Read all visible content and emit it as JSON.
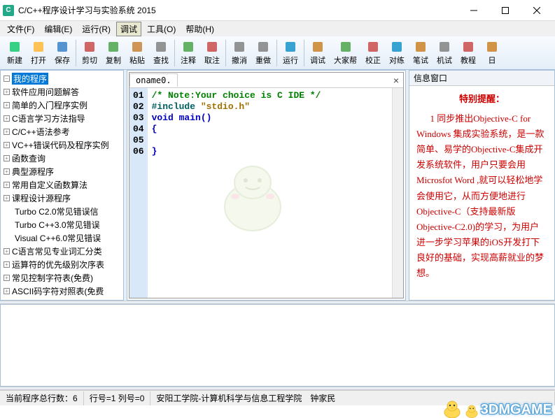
{
  "window": {
    "title": "C/C++程序设计学习与实验系统 2015"
  },
  "menu": {
    "file": "文件(F)",
    "edit": "编辑(E)",
    "run": "运行(R)",
    "debug": "调试",
    "tools": "工具(O)",
    "help": "帮助(H)"
  },
  "toolbar": [
    {
      "id": "new",
      "label": "新建",
      "color": "#2c7"
    },
    {
      "id": "open",
      "label": "打开",
      "color": "#fb4"
    },
    {
      "id": "save",
      "label": "保存",
      "color": "#48c"
    },
    {
      "sep": true
    },
    {
      "id": "cut",
      "label": "剪切",
      "color": "#c55"
    },
    {
      "id": "copy",
      "label": "复制",
      "color": "#5a5"
    },
    {
      "id": "paste",
      "label": "粘贴",
      "color": "#c84"
    },
    {
      "id": "find",
      "label": "查找",
      "color": "#888"
    },
    {
      "sep": true
    },
    {
      "id": "comment",
      "label": "注释",
      "color": "#5a5"
    },
    {
      "id": "undo",
      "label": "取注",
      "color": "#c55"
    },
    {
      "sep": true
    },
    {
      "id": "back",
      "label": "撤消",
      "color": "#888"
    },
    {
      "id": "fwd",
      "label": "重做",
      "color": "#888"
    },
    {
      "sep": true
    },
    {
      "id": "run",
      "label": "运行",
      "color": "#29c"
    },
    {
      "sep": true
    },
    {
      "id": "debug",
      "label": "调试",
      "color": "#c83"
    },
    {
      "id": "help",
      "label": "大家帮",
      "color": "#5a5"
    },
    {
      "id": "verify",
      "label": "校正",
      "color": "#c55"
    },
    {
      "id": "compare",
      "label": "对练",
      "color": "#29c"
    },
    {
      "id": "note",
      "label": "笔试",
      "color": "#c83"
    },
    {
      "id": "pc",
      "label": "机试",
      "color": "#888"
    },
    {
      "id": "tut",
      "label": "教程",
      "color": "#c55"
    },
    {
      "id": "day",
      "label": "日",
      "color": "#c83"
    }
  ],
  "tree": {
    "root": "我的程序",
    "items": [
      "软件应用问题解答",
      "简单的入门程序实例",
      "C语言学习方法指导",
      "C/C++语法参考",
      "VC++错误代码及程序实例",
      "函数查询",
      "典型源程序",
      "常用自定义函数算法",
      "课程设计源程序"
    ],
    "children": [
      "Turbo C2.0常见错误信",
      "Turbo C++3.0常见错误",
      "Visual C++6.0常见错误"
    ],
    "items2": [
      "C语言常见专业词汇分类",
      "运算符的优先级别次序表",
      "常见控制字符表(免费)",
      "ASCII码字符对照表(免费"
    ]
  },
  "editor": {
    "tab": "oname0.",
    "lines": [
      "01",
      "02",
      "03",
      "04",
      "05",
      "06"
    ],
    "l1_comment": "/* Note:Your choice is C IDE */",
    "l2_pp": "#include ",
    "l2_str": "\"stdio.h\"",
    "l3_kw": "void",
    "l3_rest": " main()",
    "l4": "{",
    "l5": "",
    "l6": "}"
  },
  "info": {
    "header": "信息窗口",
    "title": "特别提醒：",
    "text": "1 同步推出Objective-C for Windows 集成实验系统，是一款简单、易学的Objective-C集成开发系统软件，用户只要会用Microsfot Word ,就可以轻松地学会使用它，从而方便地进行Objective-C（支持最新版Objective-C2.0)的学习，为用户进一步学习苹果的iOS开发打下良好的基础，实现高薪就业的梦想。"
  },
  "status": {
    "lines": "当前程序总行数：6",
    "pos": "行号=1 列号=0",
    "school": "安阳工学院-计算机科学与信息工程学院　钟家民"
  },
  "watermark": "3DMGAME"
}
